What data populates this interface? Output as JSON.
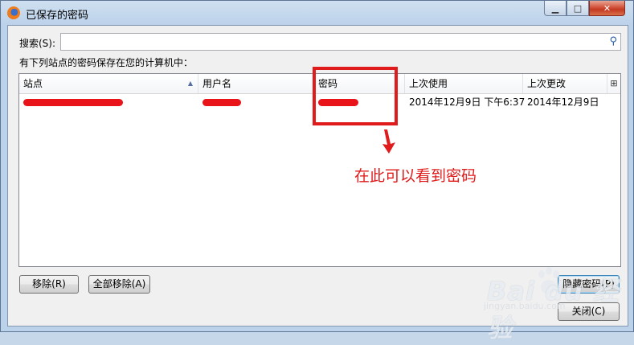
{
  "window": {
    "title": "已保存的密码",
    "controls": {
      "minimize": "▁",
      "maximize": "□",
      "close": "✕"
    }
  },
  "search": {
    "label": "搜索(S):",
    "value": "",
    "placeholder": ""
  },
  "info_text": "有下列站点的密码保存在您的计算机中：",
  "table": {
    "columns": [
      "站点",
      "用户名",
      "密码",
      "上次使用",
      "上次更改"
    ],
    "rows": [
      {
        "site": "",
        "username": "",
        "password": "",
        "last_used": "2014年12月9日 下午6:37",
        "last_changed": "2014年12月9日"
      }
    ]
  },
  "buttons": {
    "remove": "移除(R)",
    "remove_all": "全部移除(A)",
    "show_passwords": "隐藏密码(P)",
    "close": "关闭(C)"
  },
  "annotation": {
    "text": "在此可以看到密码",
    "color": "#e01b1b"
  },
  "watermark": {
    "main": "Bai du 经验",
    "sub": "jingyan.baidu.com"
  },
  "colors": {
    "redaction": "#e8141a",
    "accent": "#3c7fb1"
  }
}
